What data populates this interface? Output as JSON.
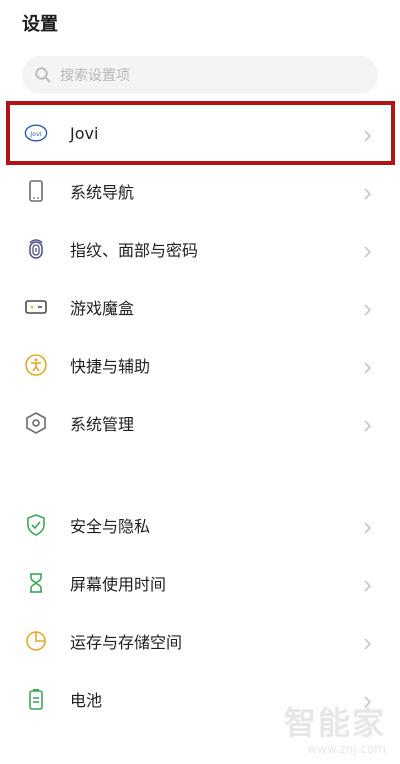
{
  "header": {
    "title": "设置"
  },
  "search": {
    "placeholder": "搜索设置项"
  },
  "menu": {
    "items": [
      {
        "label": "Jovi",
        "icon": "jovi-icon"
      },
      {
        "label": "系统导航",
        "icon": "phone-icon"
      },
      {
        "label": "指纹、面部与密码",
        "icon": "fingerprint-icon"
      },
      {
        "label": "游戏魔盒",
        "icon": "game-box-icon"
      },
      {
        "label": "快捷与辅助",
        "icon": "accessibility-icon"
      },
      {
        "label": "系统管理",
        "icon": "system-hex-icon"
      },
      {
        "label": "安全与隐私",
        "icon": "shield-check-icon"
      },
      {
        "label": "屏幕使用时间",
        "icon": "hourglass-icon"
      },
      {
        "label": "运存与存储空间",
        "icon": "storage-pie-icon"
      },
      {
        "label": "电池",
        "icon": "battery-icon"
      }
    ]
  },
  "watermark": {
    "mark": "智能家",
    "url": "www.znj.com"
  },
  "colors": {
    "highlight": "#b01414",
    "jovi_icon": "#2a5db0",
    "green": "#3aa85a",
    "gold": "#e3a92c",
    "gray": "#6c6c6c"
  }
}
